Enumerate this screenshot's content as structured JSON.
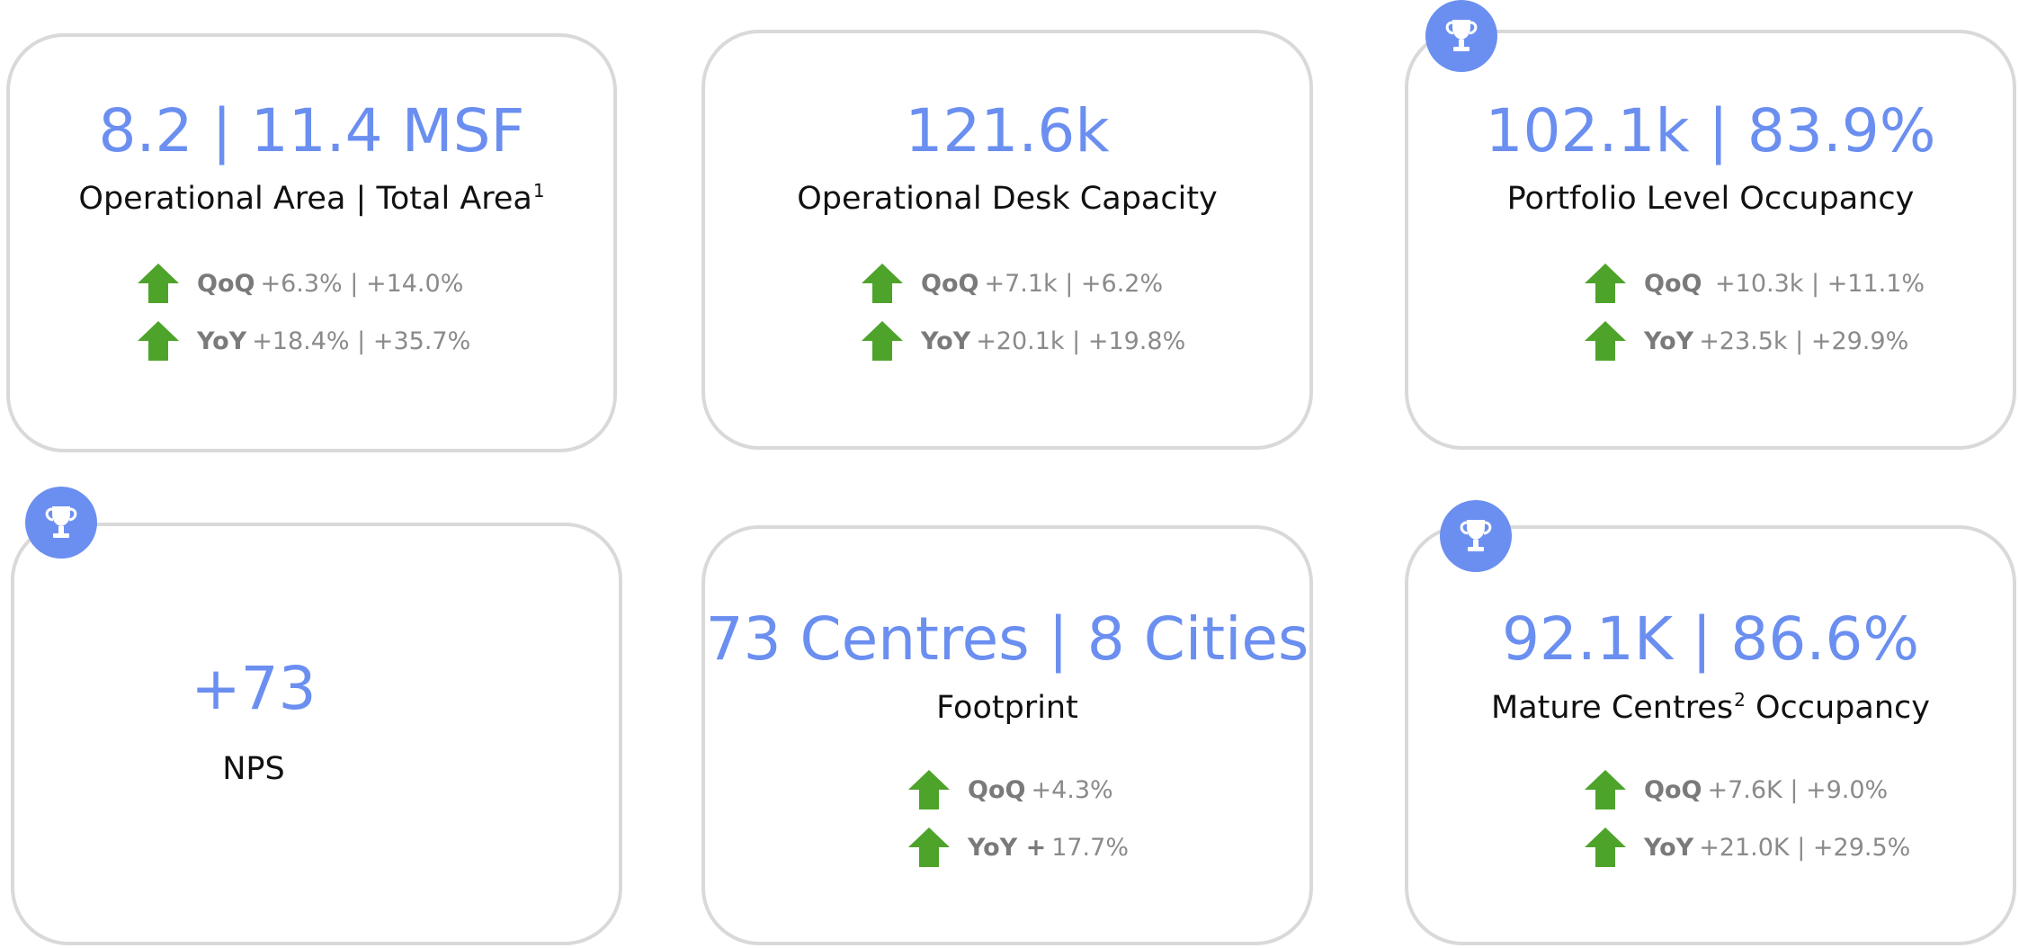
{
  "cards": [
    {
      "headline": "8.2 | 11.4 MSF",
      "subtitle": "Operational Area | Total Area",
      "subtitle_sup": "1",
      "stats": [
        {
          "label": "QoQ",
          "value": "+6.3% | +14.0%"
        },
        {
          "label": "YoY",
          "value": "+18.4%  | +35.7%"
        }
      ]
    },
    {
      "headline": "121.6k",
      "subtitle": "Operational Desk Capacity",
      "stats": [
        {
          "label": "QoQ",
          "value": "+7.1k | +6.2%"
        },
        {
          "label": "YoY",
          "value": "+20.1k | +19.8%"
        }
      ]
    },
    {
      "headline": "102.1k | 83.9%",
      "subtitle": "Portfolio Level Occupancy",
      "stats": [
        {
          "label": "QoQ",
          "value": " +10.3k | +11.1%"
        },
        {
          "label": "YoY",
          "value": "+23.5k  | +29.9%"
        }
      ]
    },
    {
      "headline": "+73",
      "subtitle": "NPS"
    },
    {
      "headline": "73 Centres | 8 Cities",
      "subtitle": "Footprint",
      "stats": [
        {
          "label": "QoQ",
          "value": "+4.3%"
        },
        {
          "label": "YoY +",
          "value": "17.7%"
        }
      ]
    },
    {
      "headline": "92.1K | 86.6%",
      "subtitle": "Mature Centres",
      "subtitle_sup": "2",
      "subtitle_tail": " Occupancy",
      "stats": [
        {
          "label": "QoQ",
          "value": "+7.6K | +9.0%"
        },
        {
          "label": "YoY",
          "value": "+21.0K  | +29.5%"
        }
      ]
    }
  ],
  "icons": {
    "trophy": "trophy-icon",
    "arrow": "arrow-up-icon"
  },
  "colors": {
    "accent": "#6b8ff0",
    "up_arrow": "#4ea32a",
    "card_border": "#d9d9d9",
    "stat_text": "#8a8a8a"
  }
}
